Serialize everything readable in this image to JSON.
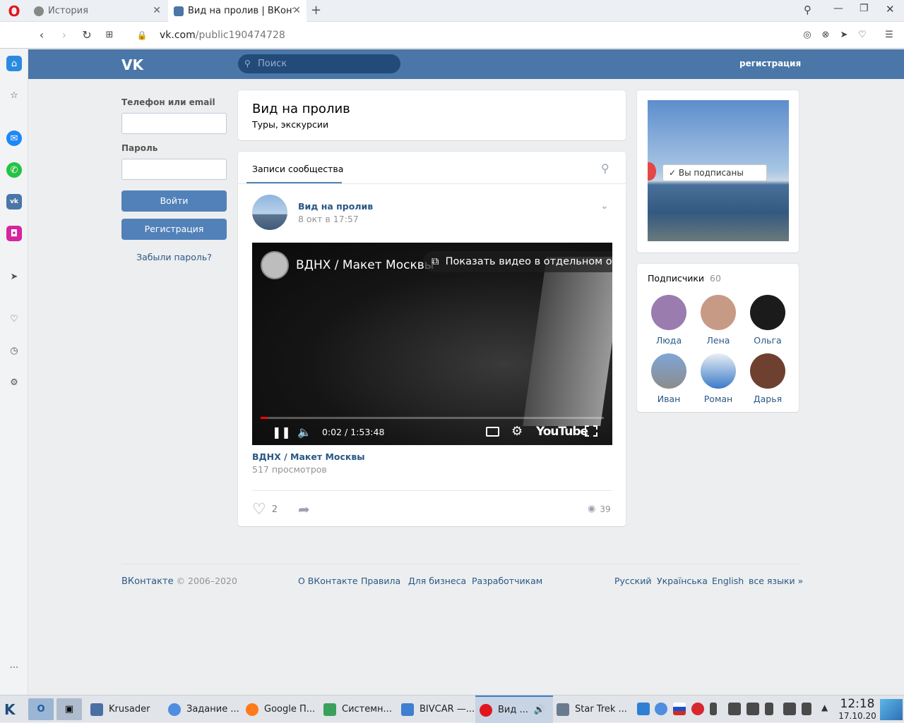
{
  "browser": {
    "tabs": [
      {
        "label": "История"
      },
      {
        "label": "Вид на пролив | ВКонт"
      }
    ],
    "url_domain": "vk.com",
    "url_path": "/public190474728"
  },
  "vk": {
    "logo": "VK",
    "search_placeholder": "Поиск",
    "register_link": "регистрация"
  },
  "login": {
    "phone_label": "Телефон или email",
    "password_label": "Пароль",
    "login_button": "Войти",
    "register_button": "Регистрация",
    "forgot_link": "Забыли пароль?"
  },
  "group": {
    "name": "Вид на пролив",
    "category": "Туры, экскурсии",
    "posts_tab": "Записи сообщества"
  },
  "post": {
    "author": "Вид на пролив",
    "date": "8 окт в 17:57",
    "video": {
      "title": "ВДНХ / Макет Москвы",
      "popout": "Показать видео в отдельном ок",
      "time": "0:02 / 1:53:48",
      "brand": "YouTube",
      "progress": 0.02
    },
    "video_link": "ВДНХ / Макет Москвы",
    "views_text": "517 просмотров",
    "likes": "2",
    "views_count": "39"
  },
  "cover": {
    "subscribed_label": "Вы подписаны"
  },
  "subscribers": {
    "title": "Подписчики",
    "count": "60",
    "people": [
      {
        "name": "Люда"
      },
      {
        "name": "Лена"
      },
      {
        "name": "Ольга"
      },
      {
        "name": "Иван"
      },
      {
        "name": "Роман"
      },
      {
        "name": "Дарья"
      }
    ]
  },
  "footer": {
    "copyright_brand": "ВКонтакте",
    "copyright_years": "© 2006–2020",
    "links": [
      "О ВКонтакте",
      "Правила",
      "Для бизнеса",
      "Разработчикам"
    ],
    "langs": [
      "Русский",
      "Українська",
      "English",
      "все языки »"
    ]
  },
  "taskbar": {
    "items": [
      {
        "label": "Krusader"
      },
      {
        "label": "Задание ..."
      },
      {
        "label": "Google П..."
      },
      {
        "label": "Системн..."
      },
      {
        "label": "BIVCAR —..."
      },
      {
        "label": "Вид ..."
      },
      {
        "label": "Star Trek ..."
      }
    ],
    "time": "12:18",
    "date": "17.10.20"
  },
  "colors": {
    "vk_blue": "#4a76a8",
    "button_blue": "#5181b8",
    "link": "#2a5885"
  }
}
